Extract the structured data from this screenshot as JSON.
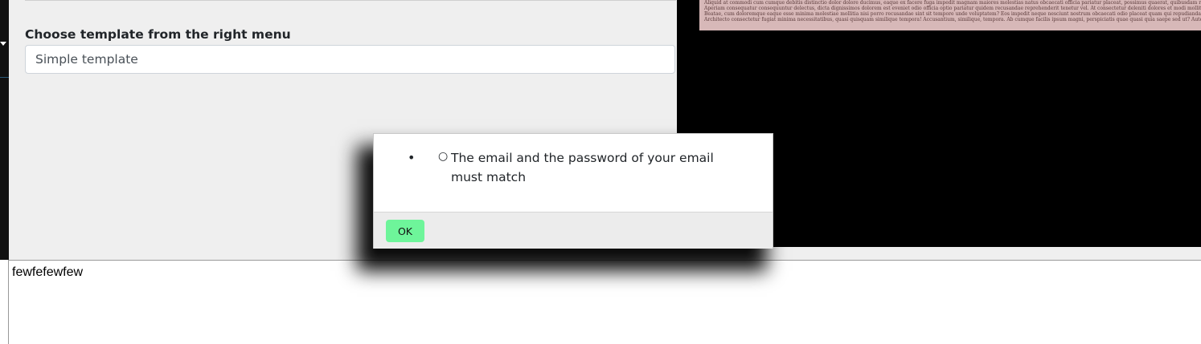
{
  "form": {
    "template_label": "Choose template from the right menu",
    "template_value": "Simple template"
  },
  "preview": {
    "lines": [
      "Aliquid at commodi cum cumque debitis distinctio dolor dolore ducimus, eaque ex facere fuga impedit magnam maiores molestias natus obcaecati officia pariatur placeat, possimus quaerat, quibusdam reprehenderit sed unde",
      "Aperiam consequatur consequuntur delectus, dicta dignissimos dolorem est eveniet odio officia optio pariatur quidem recusandae reprehenderit tenetur vel. At consectetur deleniti dolores et modi mollitia, quas quibusdam quo",
      "Beatae, cum doloremque eaque esse minima molestiae mollitia nisi porro recusandae sint sit tempore unde voluptatem? Eos impedit neque nesciunt nostrum obcaecati odio placeat quam qui repudiandae, tempora, tempore unde",
      "Architecto consectetur fugiat minima necessitatibus, quasi quisquam similique tempora! Accusantium, similique, tempora. Ab cumque facilis ipsum magni, perspiciatis quae quasi quia saepe sed ut? Autem consequuntur magni"
    ]
  },
  "editor": {
    "text": "fewfefewfew"
  },
  "modal": {
    "outer_bullet": "•",
    "inner_bullet": "○",
    "message": "The email and the password of your email must match",
    "ok_label": "OK"
  },
  "colors": {
    "ok_button": "#6ef59a",
    "panel_background": "#efefef",
    "preview_background": "#000000",
    "preview_card": "#d7b8b8"
  }
}
